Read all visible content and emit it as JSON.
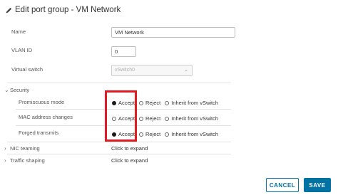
{
  "dialog": {
    "title": "Edit port group - VM Network",
    "title_icon": "pencil-icon"
  },
  "fields": {
    "name_label": "Name",
    "name_value": "VM Network",
    "vlan_label": "VLAN ID",
    "vlan_value": "0",
    "vswitch_label": "Virtual switch",
    "vswitch_value": "vSwitch0"
  },
  "security": {
    "section_label": "Security",
    "expanded": true,
    "rows": [
      {
        "label": "Promiscuous mode",
        "options": [
          "Accept",
          "Reject",
          "Inherit from vSwitch"
        ],
        "selected": "Accept"
      },
      {
        "label": "MAC address changes",
        "options": [
          "Accept",
          "Reject",
          "Inherit from vSwitch"
        ],
        "selected": ""
      },
      {
        "label": "Forged transmits",
        "options": [
          "Accept",
          "Reject",
          "Inherit from vSwitch"
        ],
        "selected": "Accept"
      }
    ]
  },
  "nic_teaming": {
    "section_label": "NIC teaming",
    "action": "Click to expand"
  },
  "traffic_shaping": {
    "section_label": "Traffic shaping",
    "action": "Click to expand"
  },
  "footer": {
    "cancel_label": "CANCEL",
    "save_label": "SAVE"
  },
  "colors": {
    "accent": "#0072a3",
    "highlight": "#e01b24"
  }
}
